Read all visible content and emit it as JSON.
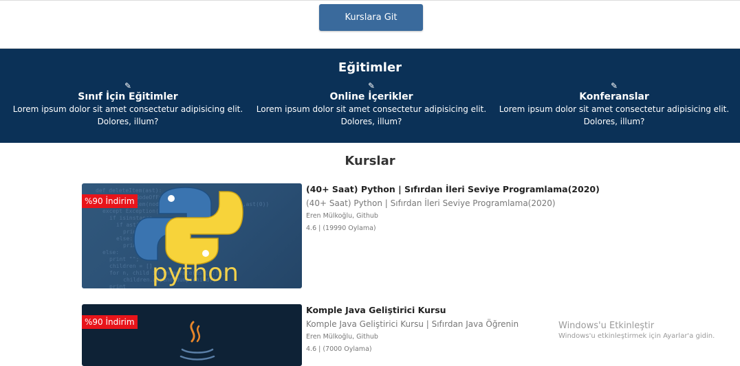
{
  "header": {
    "button_label": "Kurslara Git"
  },
  "education": {
    "title": "Eğitimler",
    "pen_icon": "pencil-icon",
    "items": [
      {
        "title": "Sınıf İçin Eğitimler",
        "desc_line1": "Lorem ipsum dolor sit amet consectetur adipisicing elit.",
        "desc_line2": "Dolores, illum?"
      },
      {
        "title": "Online İçerikler",
        "desc_line1": "Lorem ipsum dolor sit amet consectetur adipisicing elit.",
        "desc_line2": "Dolores, illum?"
      },
      {
        "title": "Konferanslar",
        "desc_line1": "Lorem ipsum dolor sit amet consectetur adipisicing elit.",
        "desc_line2": "Dolores, illum?"
      }
    ]
  },
  "courses": {
    "title": "Kurslar",
    "items": [
      {
        "badge": "%90 İndirim",
        "title": "(40+ Saat) Python | Sıfırdan İleri Seviye Programlama(2020)",
        "subtitle": "(40+ Saat) Python | Sıfırdan İleri Seviye Programlama(2020)",
        "author": "Eren Mülkoğlu, Github",
        "rating": "4.6 | (19990 Oylama)",
        "thumb_text": "python"
      },
      {
        "badge": "%90 İndirim",
        "title": "Komple Java Geliştirici Kursu",
        "subtitle": "Komple Java Geliştirici Kursu | Sıfırdan Java Öğrenin",
        "author": "Eren Mülkoğlu, Github",
        "rating": "4.6 | (7000 Oylama)"
      }
    ]
  },
  "windows_watermark": {
    "title": "Windows'u Etkinleştir",
    "subtitle": "Windows'u etkinleştirmek için Ayarlar'a gidin."
  },
  "colors": {
    "navy": "#0b3157",
    "button": "#3a6a9c",
    "badge": "#e8141a"
  }
}
